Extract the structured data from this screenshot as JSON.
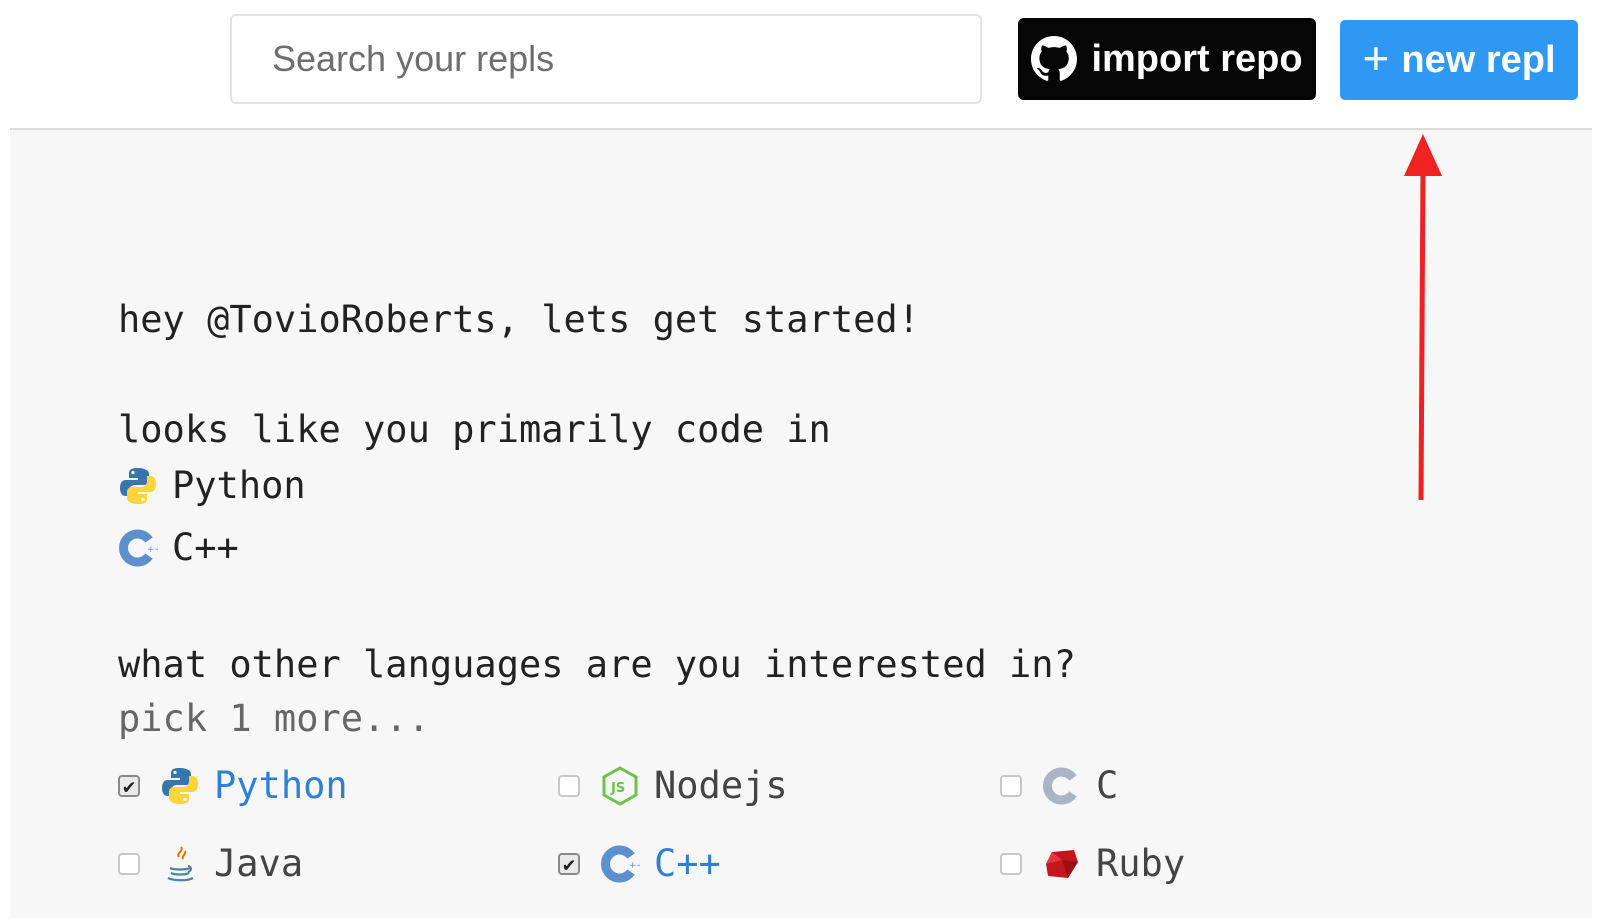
{
  "search": {
    "placeholder": "Search your repls"
  },
  "toolbar": {
    "import_label": "import repo",
    "new_label": "new repl",
    "new_plus": "+"
  },
  "main": {
    "greeting": "hey @TovioRoberts, lets get started!",
    "primary_heading": "looks like you primarily code in",
    "primary_languages": [
      {
        "label": "Python",
        "icon": "python-icon"
      },
      {
        "label": "C++",
        "icon": "cpp-icon"
      }
    ],
    "interest_question": "what other languages are you interested in?",
    "pick_hint": "pick 1 more...",
    "options": [
      {
        "label": "Python",
        "checked": true,
        "icon": "python-icon"
      },
      {
        "label": "Nodejs",
        "checked": false,
        "icon": "nodejs-icon"
      },
      {
        "label": "C",
        "checked": false,
        "icon": "c-icon"
      },
      {
        "label": "Java",
        "checked": false,
        "icon": "java-icon"
      },
      {
        "label": "C++",
        "checked": true,
        "icon": "cpp-icon"
      },
      {
        "label": "Ruby",
        "checked": false,
        "icon": "ruby-icon"
      }
    ],
    "checkmark": "✔"
  },
  "colors": {
    "new_button": "#2f98f3",
    "import_button": "#050505",
    "arrow": "#ee2222",
    "selected_label": "#2f7fd6"
  }
}
